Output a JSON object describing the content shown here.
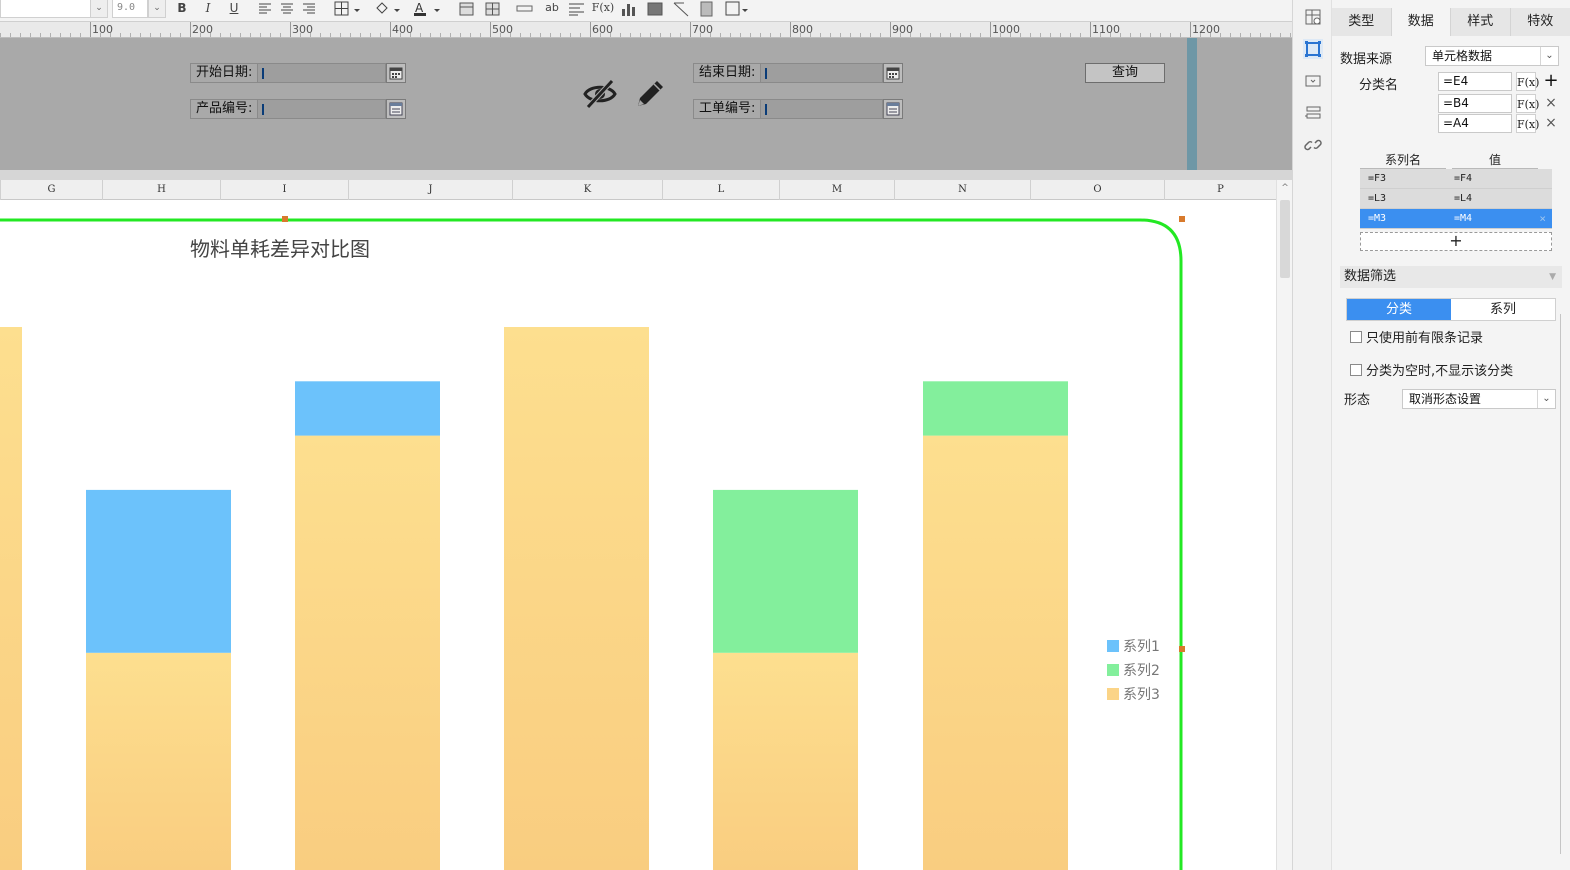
{
  "toolbar": {
    "font_size": "9.0",
    "bold_label": "B",
    "italic_label": "I",
    "underline_label": "U",
    "ab_label": "ab",
    "fx_label": "F(x)"
  },
  "ruler": {
    "labels": [
      "100",
      "200",
      "300",
      "400",
      "500",
      "600",
      "700",
      "800",
      "900",
      "1000",
      "1100",
      "1200"
    ]
  },
  "params": {
    "start_date_label": "开始日期:",
    "end_date_label": "结束日期:",
    "product_no_label": "产品编号:",
    "work_order_label": "工单编号:",
    "query_button": "查询"
  },
  "columns": [
    "G",
    "H",
    "I",
    "J",
    "K",
    "L",
    "M",
    "N",
    "O",
    "P"
  ],
  "chart_data": {
    "type": "bar",
    "stacked": true,
    "title": "物料单耗差异对比图",
    "categories": [
      "",
      "",
      "",
      "",
      "",
      "",
      ""
    ],
    "series": [
      {
        "name": "系列1",
        "color": "#6cc2fb",
        "values": [
          0,
          3,
          1,
          0,
          0,
          0,
          0
        ]
      },
      {
        "name": "系列2",
        "color": "#83ef9c",
        "values": [
          0,
          0,
          0,
          0,
          3,
          1,
          0
        ]
      },
      {
        "name": "系列3",
        "color": "#fbd487",
        "values": [
          10,
          4,
          8,
          10,
          4,
          8,
          0
        ]
      }
    ],
    "legend_position": "right",
    "grid": false
  },
  "panel": {
    "tabs": [
      "类型",
      "数据",
      "样式",
      "特效"
    ],
    "active_tab": "数据",
    "data_source_label": "数据来源",
    "data_source_value": "单元格数据",
    "category_label": "分类名",
    "category_formulas": [
      "=E4",
      "=B4",
      "=A4"
    ],
    "fx_label": "F(x)",
    "series_header_name": "系列名",
    "series_header_value": "值",
    "series_rows": [
      {
        "name": "=F3",
        "value": "=F4"
      },
      {
        "name": "=L3",
        "value": "=L4"
      },
      {
        "name": "=M3",
        "value": "=M4"
      }
    ],
    "add_symbol": "+",
    "filter_title": "数据筛选",
    "filter_tabs": [
      "分类",
      "系列"
    ],
    "check_first_records": "只使用前有限条记录",
    "check_hide_empty": "分类为空时,不显示该分类",
    "shape_label": "形态",
    "shape_value": "取消形态设置"
  },
  "colors": {
    "selection_border": "#23e823",
    "accent_blue": "#3b8ff0",
    "param_bg": "#a9a9a9"
  },
  "icons": [
    "eye-off-icon",
    "pencil-icon",
    "calendar-icon",
    "chart-type-icon",
    "select-icon",
    "cell-icon",
    "widget-icon",
    "link-icon"
  ]
}
